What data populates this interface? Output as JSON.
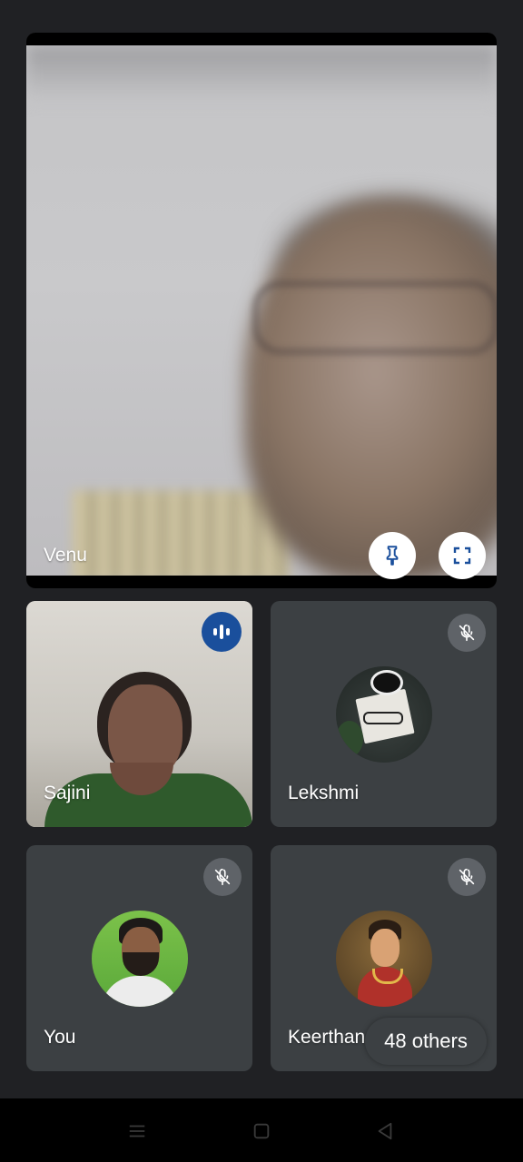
{
  "main_participant": {
    "name": "Venu"
  },
  "tiles": [
    {
      "name": "Sajini",
      "status": "speaking",
      "avatar": "camera-video"
    },
    {
      "name": "Lekshmi",
      "status": "muted",
      "avatar": "notebook-glasses-photo"
    },
    {
      "name": "You",
      "status": "muted",
      "avatar": "man-portrait-photo"
    },
    {
      "name": "Keerthana",
      "status": "muted",
      "avatar": "painting-portrait"
    }
  ],
  "others": {
    "label": "48 others"
  },
  "icons": {
    "pin": "pin-icon",
    "fullscreen": "fullscreen-icon",
    "speaking": "audio-level-icon",
    "muted": "mic-off-icon",
    "nav": [
      "menu-icon",
      "home-icon",
      "back-icon"
    ]
  },
  "colors": {
    "background": "#202124",
    "tile": "#3c4043",
    "accent": "#1a4f9c"
  }
}
